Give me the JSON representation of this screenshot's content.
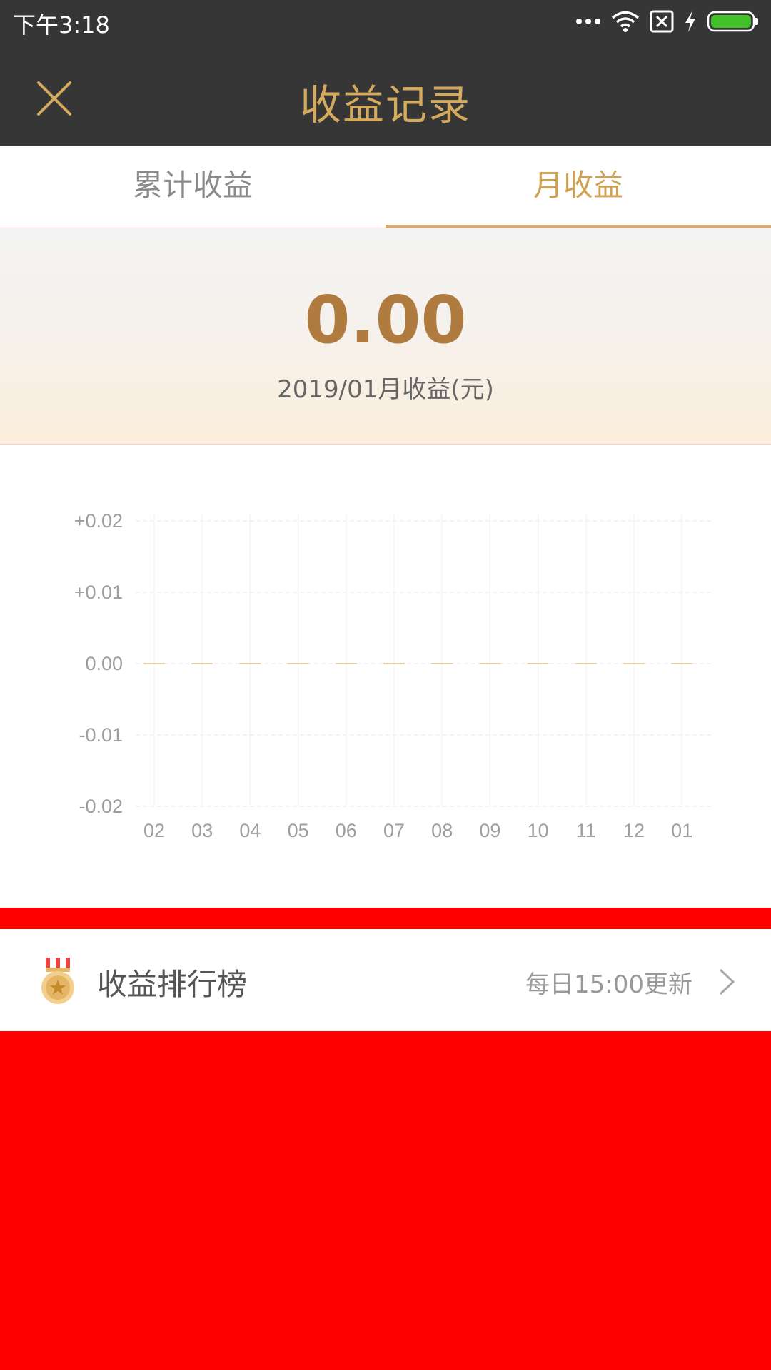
{
  "status_bar": {
    "time": "下午3:18",
    "icons": [
      "more-dots-icon",
      "wifi-icon",
      "sim-off-icon",
      "charging-bolt-icon",
      "battery-icon"
    ],
    "battery_color": "#44c02b"
  },
  "header": {
    "title": "收益记录",
    "close_icon": "close-icon",
    "background": "#363636",
    "accent": "#d4aa5e"
  },
  "tabs": [
    {
      "label": "累计收益",
      "active": false
    },
    {
      "label": "月收益",
      "active": true
    }
  ],
  "summary": {
    "amount": "0.00",
    "label": "2019/01月收益(元)"
  },
  "chart_data": {
    "type": "bar",
    "categories": [
      "02",
      "03",
      "04",
      "05",
      "06",
      "07",
      "08",
      "09",
      "10",
      "11",
      "12",
      "01"
    ],
    "values": [
      0,
      0,
      0,
      0,
      0,
      0,
      0,
      0,
      0,
      0,
      0,
      0
    ],
    "ylim": [
      -0.02,
      0.02
    ],
    "yticks": [
      "+0.02",
      "+0.01",
      "0.00",
      "-0.01",
      "-0.02"
    ],
    "grid": true,
    "bar_color": "#e0c08c"
  },
  "ranking": {
    "title": "收益排行榜",
    "subtitle": "每日15:00更新",
    "icon": "medal-icon"
  }
}
